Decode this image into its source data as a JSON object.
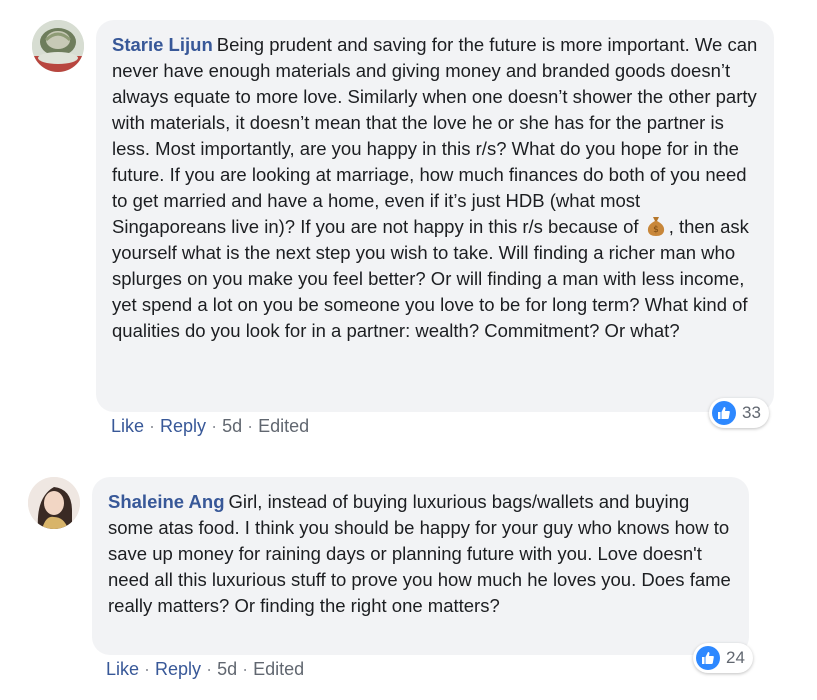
{
  "comments": [
    {
      "author": "Starie Lijun",
      "text_before_emoji": "Being prudent and saving for the future is more important. We can never have enough materials and giving money and branded goods doesn’t always equate to more love. Similarly when one doesn’t shower the other party with materials, it doesn’t mean that the love he or she has for the partner is less. Most importantly, are you happy in this r/s? What do you hope for in the future. If you are looking at marriage, how much finances do both of you need to get married and have a home, even if it’s just HDB (what most Singaporeans live in)? If you are not happy in this r/s because of",
      "emoji": "money-bag-icon",
      "text_after_emoji": ", then ask yourself what is the next step you wish to take. Will finding a richer man who splurges on you make you feel better? Or will finding a man with less income, yet spend a lot on you be someone you love to be for long term? What kind of qualities do you look for in a partner: wealth? Commitment? Or what?",
      "actions": {
        "like": "Like",
        "reply": "Reply",
        "time": "5d",
        "edited": "Edited"
      },
      "reaction_count": "33"
    },
    {
      "author": "Shaleine Ang",
      "text": "Girl, instead of buying luxurious bags/wallets and buying some atas food. I think you should be happy for your guy who knows how to save up money for raining days or planning future with you. Love doesn't need all this luxurious stuff to prove you how much he loves you. Does fame really matters? Or finding the right one matters?",
      "actions": {
        "like": "Like",
        "reply": "Reply",
        "time": "5d",
        "edited": "Edited"
      },
      "reaction_count": "24"
    }
  ],
  "separator": "·",
  "colors": {
    "author": "#385898",
    "bubble": "#f2f3f5",
    "like_reaction": "#2d88ff"
  }
}
